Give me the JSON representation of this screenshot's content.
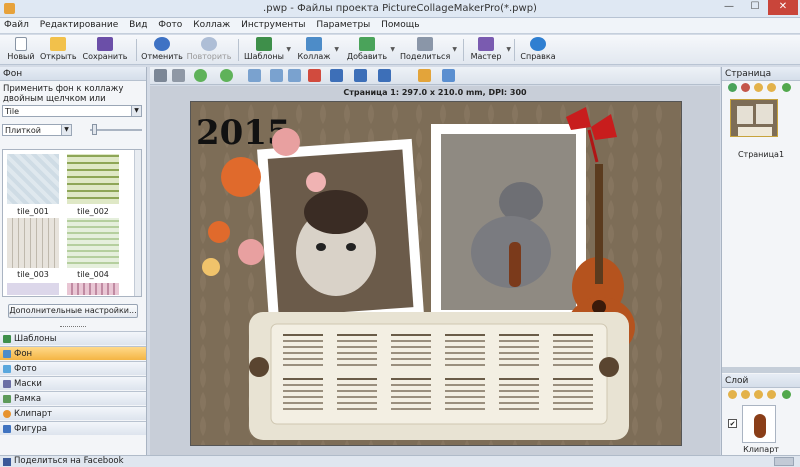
{
  "window": {
    "title": ".pwp - Файлы проекта PictureCollageMakerPro(*.pwp)",
    "minimize": "—",
    "maximize": "☐",
    "close": "✕"
  },
  "menu": [
    "Файл",
    "Редактирование",
    "Вид",
    "Фото",
    "Коллаж",
    "Инструменты",
    "Параметры",
    "Помощь"
  ],
  "toolbar": {
    "new": "Новый",
    "open": "Открыть",
    "save": "Сохранить",
    "undo": "Отменить",
    "redo": "Повторить",
    "templates": "Шаблоны",
    "collage": "Коллаж",
    "add": "Добавить",
    "share": "Поделиться",
    "wizard": "Мастер",
    "help": "Справка"
  },
  "left_panel": {
    "title": "Фон",
    "hint": "Применить фон к коллажу двойным щелчком или перетаскиванием",
    "category": "Tile",
    "fill_mode": "Плиткой",
    "tiles": [
      "tile_001",
      "tile_002",
      "tile_003",
      "tile_004"
    ],
    "more_settings": "Дополнительные настройки...",
    "sections": [
      "Шаблоны",
      "Фон",
      "Фото",
      "Маски",
      "Рамка",
      "Клипарт",
      "Фигура"
    ],
    "selected_section": "Фон"
  },
  "canvas": {
    "page_info": "Страница  1: 297.0 x 210.0 mm, DPI: 300",
    "year": "2015",
    "calendar_months": 12
  },
  "right_panel": {
    "pages_title": "Страница",
    "page_label": "Страница1",
    "layers_title": "Слой",
    "layer_label": "Клипарт",
    "layer_checked": "✔"
  },
  "status": {
    "share_facebook": "Поделиться на Facebook"
  },
  "colors": {
    "accent": "#f4b544",
    "window_bg": "#d4dbe6",
    "collage_bg": "#7d6d57"
  }
}
